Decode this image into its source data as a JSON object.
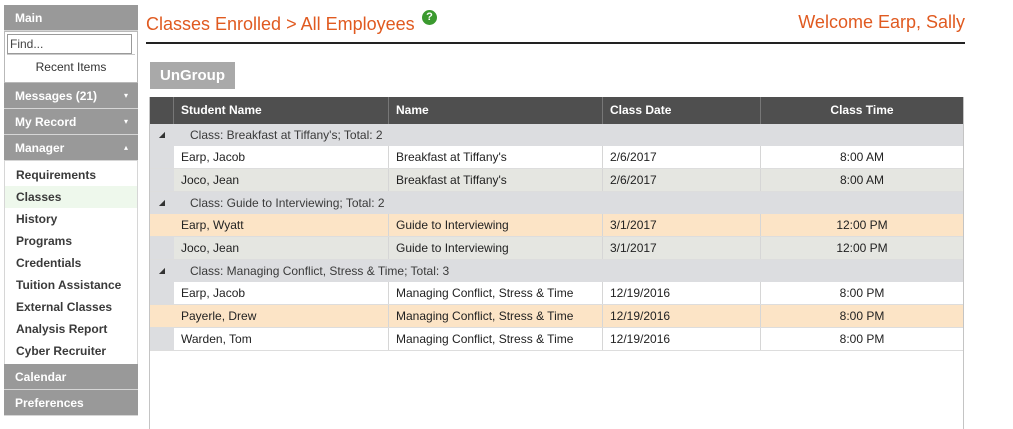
{
  "sidebar": {
    "main_label": "Main",
    "search_placeholder": "Find...",
    "recent_items": "Recent Items",
    "messages_label": "Messages (21)",
    "my_record_label": "My Record",
    "manager_label": "Manager",
    "manager_items": [
      {
        "label": "Requirements"
      },
      {
        "label": "Classes"
      },
      {
        "label": "History"
      },
      {
        "label": "Programs"
      },
      {
        "label": "Credentials"
      },
      {
        "label": "Tuition Assistance"
      },
      {
        "label": "External Classes"
      },
      {
        "label": "Analysis Report"
      },
      {
        "label": "Cyber Recruiter"
      }
    ],
    "calendar_label": "Calendar",
    "preferences_label": "Preferences"
  },
  "header": {
    "title": "Classes Enrolled > All Employees",
    "help": "?",
    "welcome": "Welcome Earp, Sally"
  },
  "ungroup_label": "UnGroup",
  "grid": {
    "columns": [
      "Student Name",
      "Name",
      "Class Date",
      "Class Time"
    ],
    "groups": [
      {
        "label": "Class: Breakfast at Tiffany's; Total: 2",
        "rows": [
          {
            "student": "Earp, Jacob",
            "name": "Breakfast at Tiffany's",
            "date": "2/6/2017",
            "time": "8:00 AM"
          },
          {
            "student": "Joco, Jean",
            "name": "Breakfast at Tiffany's",
            "date": "2/6/2017",
            "time": "8:00 AM"
          }
        ]
      },
      {
        "label": "Class: Guide to Interviewing; Total: 2",
        "rows": [
          {
            "student": "Earp, Wyatt",
            "name": "Guide to Interviewing",
            "date": "3/1/2017",
            "time": "12:00 PM"
          },
          {
            "student": "Joco, Jean",
            "name": "Guide to Interviewing",
            "date": "3/1/2017",
            "time": "12:00 PM"
          }
        ]
      },
      {
        "label": "Class: Managing Conflict, Stress & Time; Total: 3",
        "rows": [
          {
            "student": "Earp, Jacob",
            "name": "Managing Conflict, Stress & Time",
            "date": "12/19/2016",
            "time": "8:00 PM"
          },
          {
            "student": "Payerle, Drew",
            "name": "Managing Conflict, Stress & Time",
            "date": "12/19/2016",
            "time": "8:00 PM"
          },
          {
            "student": "Warden, Tom",
            "name": "Managing Conflict, Stress & Time",
            "date": "12/19/2016",
            "time": "8:00 PM"
          }
        ]
      }
    ]
  },
  "colors": {
    "accent": "#e05a20",
    "sidebar_header": "#999999",
    "grid_header": "#4f4f4f",
    "highlight_row": "#fce4c6",
    "help_icon": "#3b9a2f"
  },
  "icons": {
    "collapse": "▾",
    "expand": "▴",
    "group_toggle": "◢"
  }
}
